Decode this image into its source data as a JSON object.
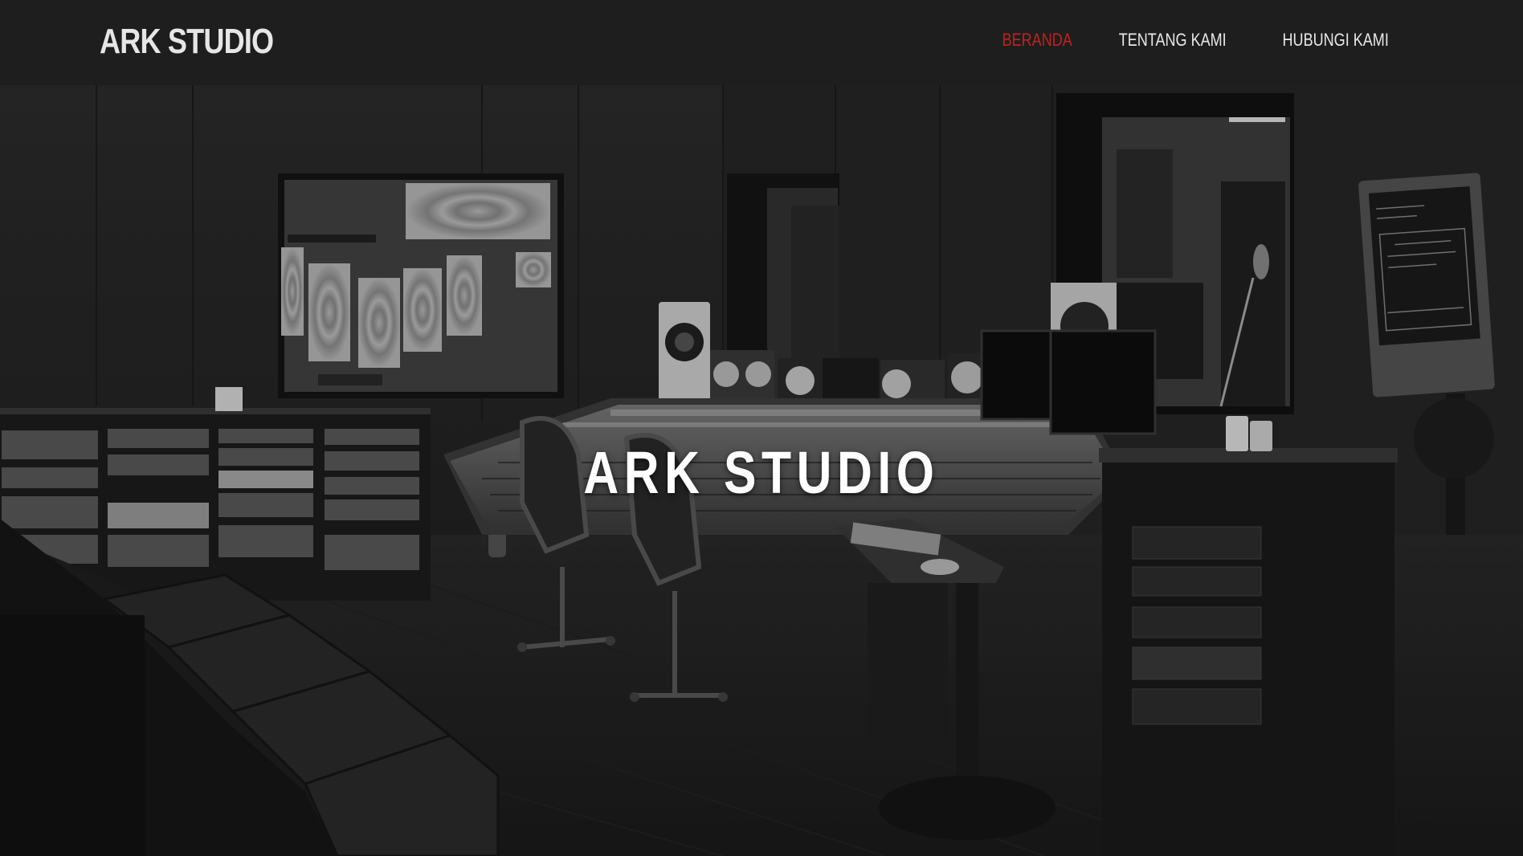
{
  "brand": {
    "name": "ARK STUDIO"
  },
  "nav": {
    "items": [
      {
        "label": "BERANDA",
        "active": true
      },
      {
        "label": "TENTANG KAMI",
        "active": false
      },
      {
        "label": "HUBUNGI KAMI",
        "active": false
      }
    ]
  },
  "hero": {
    "title": "ARK STUDIO",
    "image": "recording-studio-control-room-photo"
  },
  "colors": {
    "navbar_bg": "#1e1e1e",
    "active_link": "#c0221f",
    "link": "#e8e8e8"
  }
}
